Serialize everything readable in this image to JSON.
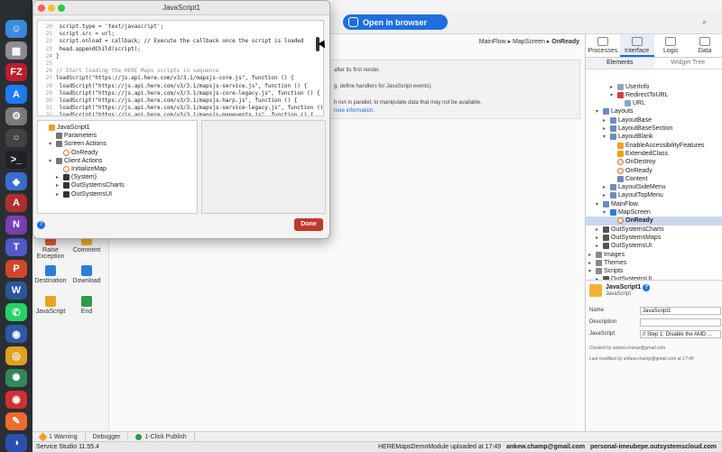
{
  "dialog": {
    "title": "JavaScript1",
    "done_label": "Done",
    "help": "?",
    "code_lines": [
      {
        "n": "20",
        "t": "    script.type = 'text/javascript';"
      },
      {
        "n": "21",
        "t": "    script.src = url;"
      },
      {
        "n": "22",
        "t": "    script.onload = callback;  // Execute the callback once the script is loaded"
      },
      {
        "n": "23",
        "t": "    head.appendChild(script);"
      },
      {
        "n": "24",
        "t": "}"
      },
      {
        "n": "25",
        "t": ""
      },
      {
        "n": "26",
        "t": "// Start loading the HERE Maps scripts in sequence"
      },
      {
        "n": "27",
        "t": "loadScript(\"https://js.api.here.com/v3/3.1/mapsjs-core.js\", function () {"
      },
      {
        "n": "28",
        "t": "    loadScript(\"https://js.api.here.com/v3/3.1/mapsjs-service.js\", function () {"
      },
      {
        "n": "29",
        "t": "      loadScript(\"https://js.api.here.com/v3/3.1/mapsjs-core-legacy.js\", function () {"
      },
      {
        "n": "30",
        "t": "        loadScript(\"https://js.api.here.com/v3/3.1/mapsjs-harp.js\", function () {"
      },
      {
        "n": "31",
        "t": "          loadScript(\"https://js.api.here.com/v3/3.1/mapsjs-service-legacy.js\", function ()"
      },
      {
        "n": "32",
        "t": "            loadScript(\"https://js.api.here.com/v3/3.1/mapsjs-mapevents.js\", function () {"
      }
    ],
    "tree": [
      {
        "label": "JavaScript1",
        "icon": "js-icon",
        "depth": 0,
        "arrow": ""
      },
      {
        "label": "Parameters",
        "icon": "folder-icon",
        "depth": 1,
        "arrow": ""
      },
      {
        "label": "Screen Actions",
        "icon": "folder-icon",
        "depth": 1,
        "arrow": "▾"
      },
      {
        "label": "OnReady",
        "icon": "action-icon",
        "depth": 2,
        "arrow": ""
      },
      {
        "label": "Client Actions",
        "icon": "folder-icon",
        "depth": 1,
        "arrow": "▾"
      },
      {
        "label": "InitializeMap",
        "icon": "action-icon",
        "depth": 2,
        "arrow": ""
      },
      {
        "label": "(System)",
        "icon": "module-icon",
        "depth": 2,
        "arrow": "▸"
      },
      {
        "label": "OutSystemsCharts",
        "icon": "module-icon",
        "depth": 2,
        "arrow": "▸"
      },
      {
        "label": "OutSystemsUI",
        "icon": "module-icon",
        "depth": 2,
        "arrow": "▸"
      }
    ]
  },
  "topbar": {
    "open_browser_label": "Open in browser"
  },
  "canvas": {
    "breadcrumb_path": "MainFlow ▸ MapScreen ▸ ",
    "breadcrumb_current": "OnReady",
    "desc_lines": [
      "after its first render.",
      "",
      "g. define handlers for JavaScript events).",
      "",
      "h run in parallel, to manipulate data that may not be available.",
      "nore information."
    ]
  },
  "toolbox": [
    {
      "label": "Raise Exception",
      "color": "#e05a3a"
    },
    {
      "label": "Comment",
      "color": "#e8b428"
    },
    {
      "label": "Destination",
      "color": "#2d7cd8"
    },
    {
      "label": "Download",
      "color": "#2d7cd8"
    },
    {
      "label": "JavaScript",
      "color": "#f0a020"
    },
    {
      "label": "End",
      "color": "#2e9b46"
    }
  ],
  "rightpanel": {
    "tabs": [
      "Processes",
      "Interface",
      "Logic",
      "Data"
    ],
    "active_tab": "Interface",
    "subtabs": [
      "Elements",
      "Widget Tree"
    ],
    "tree": [
      {
        "label": "UserInfo",
        "depth": 3,
        "arrow": "▸",
        "icon": "#8aa4c8"
      },
      {
        "label": "RedirectToURL",
        "depth": 3,
        "arrow": "▾",
        "icon": "#d04040"
      },
      {
        "label": "URL",
        "depth": 4,
        "arrow": "",
        "icon": "#8aa4c8"
      },
      {
        "label": "Layouts",
        "depth": 1,
        "arrow": "▾",
        "icon": "#6a8cc0"
      },
      {
        "label": "LayoutBase",
        "depth": 2,
        "arrow": "▸",
        "icon": "#6a8cc0"
      },
      {
        "label": "LayoutBaseSection",
        "depth": 2,
        "arrow": "▸",
        "icon": "#6a8cc0"
      },
      {
        "label": "LayoutBlank",
        "depth": 2,
        "arrow": "▾",
        "icon": "#6a8cc0"
      },
      {
        "label": "EnableAccessibilityFeatures",
        "depth": 3,
        "arrow": "",
        "icon": "#f0a020"
      },
      {
        "label": "ExtendedClass",
        "depth": 3,
        "arrow": "",
        "icon": "#f0a020"
      },
      {
        "label": "OnDestroy",
        "depth": 3,
        "arrow": "",
        "icon": "#e8e8e8"
      },
      {
        "label": "OnReady",
        "depth": 3,
        "arrow": "",
        "icon": "#e8e8e8"
      },
      {
        "label": "Content",
        "depth": 3,
        "arrow": "",
        "icon": "#6a8cc0"
      },
      {
        "label": "LayoutSideMenu",
        "depth": 2,
        "arrow": "▸",
        "icon": "#6a8cc0"
      },
      {
        "label": "LayoutTopMenu",
        "depth": 2,
        "arrow": "▸",
        "icon": "#6a8cc0"
      },
      {
        "label": "MainFlow",
        "depth": 1,
        "arrow": "▾",
        "icon": "#6a8cc0"
      },
      {
        "label": "MapScreen",
        "depth": 2,
        "arrow": "▾",
        "icon": "#2d7cd8"
      },
      {
        "label": "OnReady",
        "depth": 3,
        "arrow": "",
        "icon": "#e8e8e8",
        "sel": true
      },
      {
        "label": "OutSystemsCharts",
        "depth": 1,
        "arrow": "▸",
        "icon": "#555"
      },
      {
        "label": "OutSystemsMaps",
        "depth": 1,
        "arrow": "▸",
        "icon": "#555"
      },
      {
        "label": "OutSystemsUI",
        "depth": 1,
        "arrow": "▸",
        "icon": "#555"
      },
      {
        "label": "Images",
        "depth": 0,
        "arrow": "▸",
        "icon": "#8a8a8a"
      },
      {
        "label": "Themes",
        "depth": 0,
        "arrow": "▸",
        "icon": "#8a8a8a"
      },
      {
        "label": "Scripts",
        "depth": 0,
        "arrow": "▾",
        "icon": "#8a8a8a"
      },
      {
        "label": "OutSystemsUI",
        "depth": 1,
        "arrow": "▸",
        "icon": "#555"
      }
    ],
    "props": {
      "name_title": "JavaScript1",
      "type_title": "JavaScript",
      "help": "?",
      "name_label": "Name",
      "name_value": "JavaScript1",
      "description_label": "Description",
      "description_value": "",
      "javascript_label": "JavaScript",
      "javascript_value": "// Step 1: Disable the AMD ...",
      "created_by": "Created by ankew.champ@gmail.com",
      "modified_by": "Last modified by ankew.champ@gmail.com at 17:49"
    }
  },
  "bottom_tabs": [
    {
      "label": "1 Warning",
      "icon": "warning-icon"
    },
    {
      "label": "Debugger",
      "icon": ""
    },
    {
      "label": "1-Click Publish",
      "icon": "check-icon"
    }
  ],
  "status": {
    "version": "Service Studio 11.55.4",
    "upload": "HEREMapsDemoModule uploaded at 17:49",
    "user": "ankew.champ@gmail.com",
    "server": "personal-imeubepe.outsystemscloud.com"
  },
  "dock_icons": [
    {
      "name": "finder-icon",
      "color": "#3b8ce0",
      "glyph": "☺"
    },
    {
      "name": "launchpad-icon",
      "color": "#8e8e93",
      "glyph": "▦"
    },
    {
      "name": "filezilla-icon",
      "color": "#bf1e2d",
      "glyph": "FZ"
    },
    {
      "name": "appstore-icon",
      "color": "#1f7cf0",
      "glyph": "A"
    },
    {
      "name": "settings-icon",
      "color": "#7d7d7d",
      "glyph": "⚙"
    },
    {
      "name": "outsystems-icon",
      "color": "#444",
      "glyph": "○"
    },
    {
      "name": "terminal-icon",
      "color": "#222",
      "glyph": ">_"
    },
    {
      "name": "arc-icon",
      "color": "#3a6fd0",
      "glyph": "◆"
    },
    {
      "name": "dictionary-icon",
      "color": "#b03030",
      "glyph": "A"
    },
    {
      "name": "onenote-icon",
      "color": "#7b3fb5",
      "glyph": "N"
    },
    {
      "name": "teams-icon",
      "color": "#5059c9",
      "glyph": "T"
    },
    {
      "name": "powerpoint-icon",
      "color": "#d24726",
      "glyph": "P"
    },
    {
      "name": "word-icon",
      "color": "#2b579a",
      "glyph": "W"
    },
    {
      "name": "whatsapp-icon",
      "color": "#25d366",
      "glyph": "✆"
    },
    {
      "name": "vpn-icon",
      "color": "#2a5aa8",
      "glyph": "◉"
    },
    {
      "name": "chrome-icon",
      "color": "#e0a020",
      "glyph": "◎"
    },
    {
      "name": "electron-icon",
      "color": "#2e8b57",
      "glyph": "✺"
    },
    {
      "name": "music-icon",
      "color": "#d03030",
      "glyph": "◉"
    },
    {
      "name": "postman-icon",
      "color": "#ef6a2d",
      "glyph": "✎"
    },
    {
      "name": "arc2-icon",
      "color": "#2b4fb0",
      "glyph": "◑"
    }
  ]
}
